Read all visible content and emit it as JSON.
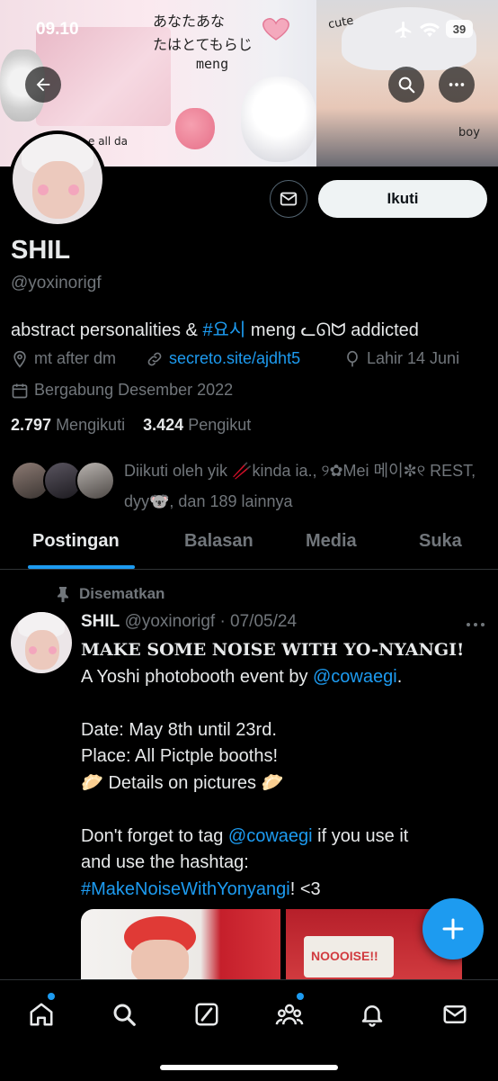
{
  "status_bar": {
    "time": "09.10",
    "battery": "39"
  },
  "banner": {
    "jp_line1": "あなたあな",
    "jp_line2": "たはとてもらじ",
    "jp_line3": "meng",
    "sticker_cute": "cute",
    "sticker_boy": "boy",
    "sticker_small": "e all da"
  },
  "profile": {
    "name": "SHIL",
    "handle": "@yoxinorigf",
    "follow_label": "Ikuti",
    "bio_prefix": "abstract personalities & ",
    "bio_hashtag": "#요시",
    "bio_suffix": " meng ᓚᘏᗢ addicted",
    "location": "mt after dm",
    "website": "secreto.site/ajdht5",
    "birthday": "Lahir 14 Juni",
    "joined": "Bergabung Desember 2022",
    "following_count": "2.797",
    "following_label": "Mengikuti",
    "followers_count": "3.424",
    "followers_label": "Pengikut",
    "followed_by": "Diikuti oleh yik 🥢kinda ia., ୨✿Mei 메이✼୧ REST, dyy🐨, dan 189 lainnya"
  },
  "tabs": [
    "Postingan",
    "Balasan",
    "Media",
    "Suka"
  ],
  "post": {
    "pinned_label": "Disematkan",
    "author": "SHIL",
    "handle_date": "@yoxinorigf · 07/05/24",
    "title": "MAKE SOME NOISE WITH YO-NYANGI!",
    "line1_prefix": "A Yoshi photobooth event by ",
    "mention": "@cowaegi",
    "line1_suffix": ".",
    "date_line": "Date: May 8th until 23rd.",
    "place_line": "Place: All Pictple booths!",
    "details_line": "🥟 Details on pictures 🥟",
    "tag_prefix": "Don't forget to tag ",
    "tag_suffix": " if you use it",
    "hashtag_line_prefix": "and use the hashtag:",
    "hashtag": "#MakeNoiseWithYonyangi",
    "hashtag_suffix": "! <3",
    "media_text": "NOOOISE!!"
  },
  "colors": {
    "accent": "#1d9bf0",
    "muted": "#71767b",
    "text": "#e7e9ea",
    "bg": "#000000"
  }
}
